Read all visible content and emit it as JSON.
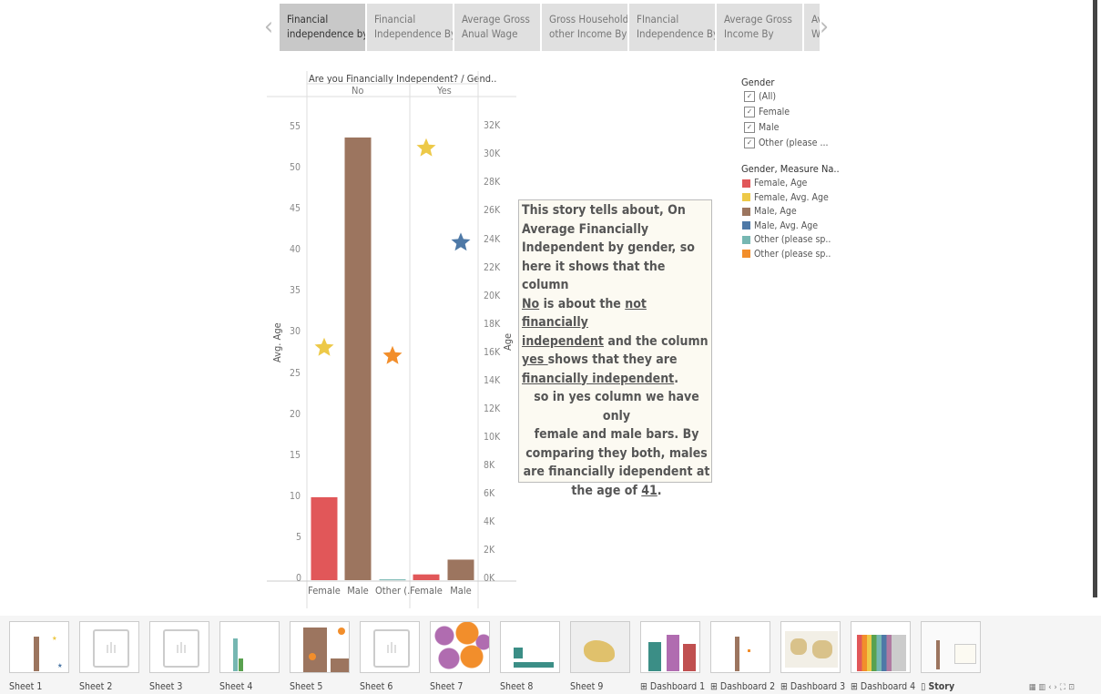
{
  "story_nav": {
    "points": [
      [
        "Financial",
        "independence by"
      ],
      [
        "Financial",
        "Independence By"
      ],
      [
        "Average Gross",
        "Anual Wage"
      ],
      [
        "Gross Household",
        "other Income By"
      ],
      [
        "FInancial",
        "Independence By"
      ],
      [
        "Average Gross",
        "Income By"
      ],
      [
        "Av",
        "Wa"
      ]
    ]
  },
  "chart": {
    "header_title": "Are you Financially Independent? / Gend..",
    "col_no": "No",
    "col_yes": "Yes",
    "left_axis_label": "Avg. Age",
    "right_axis_label": "Age",
    "left_ticks": [
      "55",
      "50",
      "45",
      "40",
      "35",
      "30",
      "25",
      "20",
      "15",
      "10",
      "5",
      "0"
    ],
    "right_ticks": [
      "32K",
      "30K",
      "28K",
      "26K",
      "24K",
      "22K",
      "20K",
      "18K",
      "16K",
      "14K",
      "12K",
      "10K",
      "8K",
      "6K",
      "4K",
      "2K",
      "0K"
    ],
    "x_labels": [
      "Female",
      "Male",
      "Other (...",
      "Female",
      "Male"
    ]
  },
  "chart_data": {
    "type": "bar",
    "title": "Are you Financially Independent? / Gend..",
    "xlabel": "",
    "ylabel": "Avg. Age",
    "y2label": "Age",
    "groups": [
      "No",
      "Yes"
    ],
    "categories": [
      "No / Female",
      "No / Male",
      "No / Other (...",
      "Yes / Female",
      "Yes / Male"
    ],
    "bars_age_sum": [
      {
        "category": "No / Female",
        "value": 10.1,
        "color": "#e15759"
      },
      {
        "category": "No / Male",
        "value": 53.9,
        "color": "#9c755f"
      },
      {
        "category": "No / Other (...",
        "value": 0.1,
        "color": "#76b7b2"
      },
      {
        "category": "Yes / Female",
        "value": 0.7,
        "color": "#e15759"
      },
      {
        "category": "Yes / Male",
        "value": 2.5,
        "color": "#9c755f"
      }
    ],
    "stars_avg_age": [
      {
        "category": "No / Female",
        "value": 28.3,
        "color": "#edc948"
      },
      {
        "category": "No / Other (...",
        "value": 27.3,
        "color": "#f28e2b"
      },
      {
        "category": "Yes / Female",
        "value": 52.6,
        "color": "#edc948"
      },
      {
        "category": "Yes / Male",
        "value": 41.1,
        "color": "#4e79a7"
      }
    ],
    "ylim": [
      0,
      58
    ],
    "y2lim": [
      0,
      33700
    ]
  },
  "legend": {
    "gender_title": "Gender",
    "gender_items": [
      "(All)",
      "Female",
      "Male",
      "Other (please ..."
    ],
    "measure_title": "Gender, Measure Na..",
    "measure_items": [
      {
        "label": "Female, Age",
        "color": "#e15759"
      },
      {
        "label": "Female, Avg. Age",
        "color": "#edc948"
      },
      {
        "label": "Male, Age",
        "color": "#9c755f"
      },
      {
        "label": "Male, Avg. Age",
        "color": "#4e79a7"
      },
      {
        "label": "Other (please sp..",
        "color": "#76b7b2"
      },
      {
        "label": "Other (please sp..",
        "color": "#f28e2b"
      }
    ]
  },
  "story_text": {
    "l1": "This story tells about, On",
    "l2": "Average Financially",
    "l3": "Independent by gender, so",
    "l4": "here it shows that the column",
    "l5_u": "No",
    "l5_rest": " is about the ",
    "l5_u2": "not financially",
    "l6_u": "independent",
    "l6_rest": " and the column",
    "l7_u": "yes ",
    "l7_rest": "shows that they are",
    "l8_u": "financially independent",
    "l8_rest": ".",
    "l9": "so in yes column we have only",
    "l10": "female and male bars. By",
    "l11": "comparing they both, males",
    "l12": "are  financially idependent at",
    "l13_pre": "the age of ",
    "l13_u": "41",
    "l13_post": "."
  },
  "tabs": [
    "Sheet 1",
    "Sheet 2",
    "Sheet 3",
    "Sheet 4",
    "Sheet 5",
    "Sheet 6",
    "Sheet 7",
    "Sheet 8",
    "Sheet 9",
    "Dashboard 1",
    "Dashboard 2",
    "Dashboard 3",
    "Dashboard 4",
    "Story"
  ],
  "tab_prefix_dashboard": "⊞",
  "tab_prefix_story": "▯"
}
